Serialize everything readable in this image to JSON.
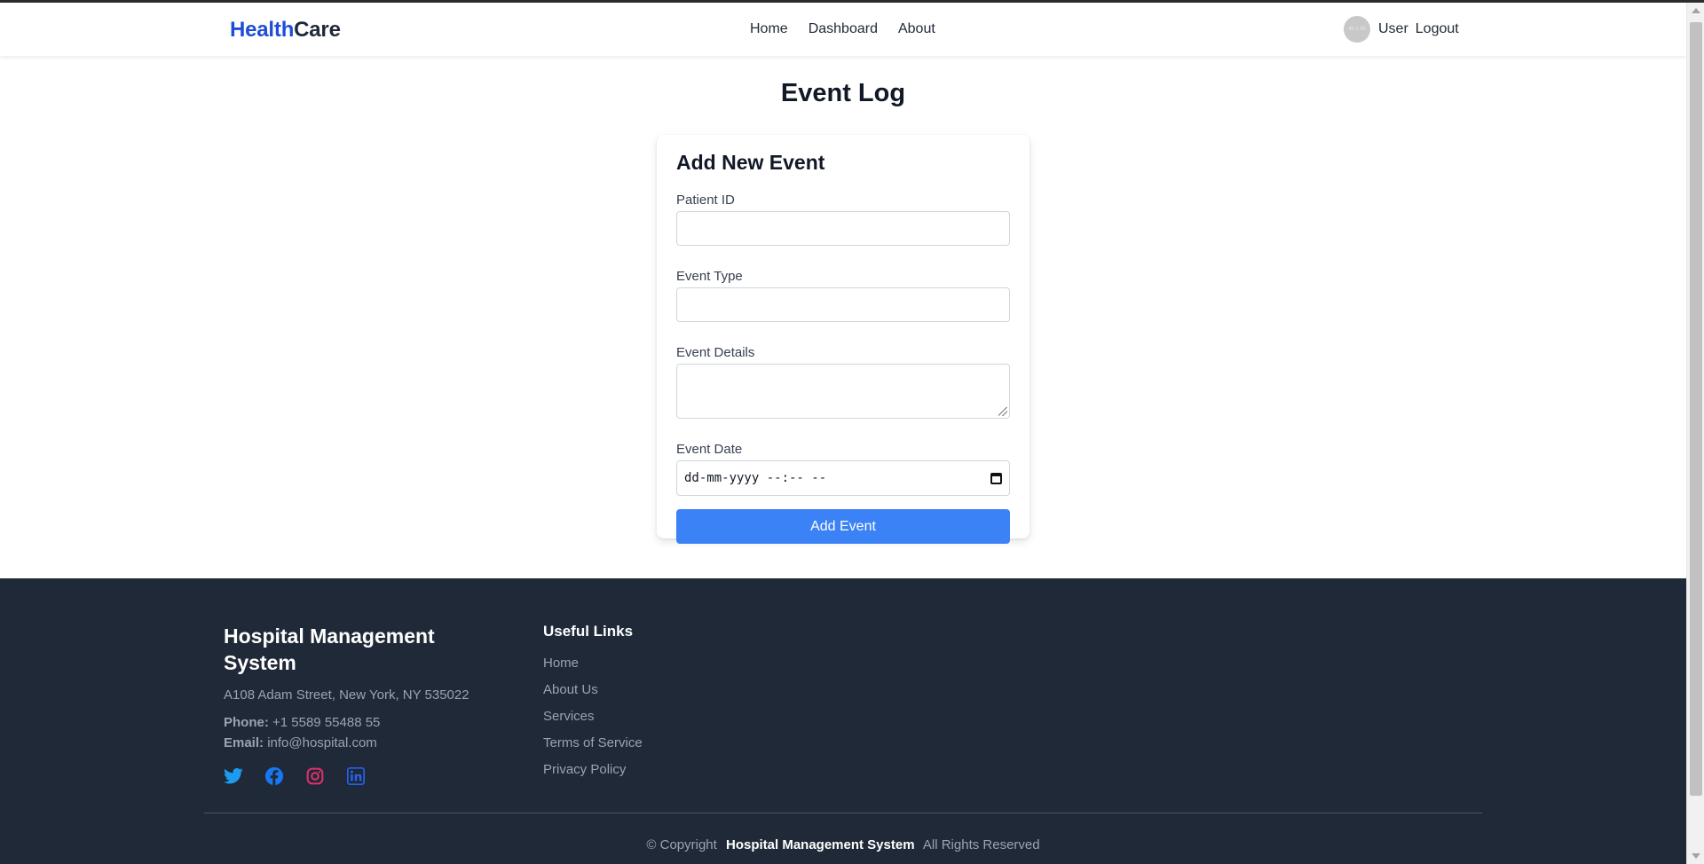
{
  "header": {
    "logo_part1": "Health",
    "logo_part2": "Care",
    "nav": [
      "Home",
      "Dashboard",
      "About"
    ],
    "avatar_text": "40 x 40",
    "user_label": "User",
    "logout_label": "Logout"
  },
  "main": {
    "title": "Event Log",
    "form": {
      "title": "Add New Event",
      "patient_id_label": "Patient ID",
      "patient_id_value": "",
      "event_type_label": "Event Type",
      "event_type_value": "",
      "event_details_label": "Event Details",
      "event_details_value": "",
      "event_date_label": "Event Date",
      "event_date_placeholder": "dd-mm-yyyy --:-- --",
      "submit_label": "Add Event"
    }
  },
  "footer": {
    "brand": "Hospital Management System",
    "address": "A108 Adam Street, New York, NY 535022",
    "phone_label": "Phone:",
    "phone_value": "+1 5589 55488 55",
    "email_label": "Email:",
    "email_value": "info@hospital.com",
    "socials": [
      "twitter-icon",
      "facebook-icon",
      "instagram-icon",
      "linkedin-icon"
    ],
    "links_title": "Useful Links",
    "links": [
      "Home",
      "About Us",
      "Services",
      "Terms of Service",
      "Privacy Policy"
    ],
    "copyright_prefix": "© Copyright",
    "copyright_name": "Hospital Management System",
    "copyright_suffix": "All Rights Reserved"
  },
  "colors": {
    "brand_blue": "#1d4ed8",
    "button_blue": "#3b82f6",
    "footer_bg": "#1f2937",
    "twitter": "#1d9bf0",
    "facebook": "#1877f2",
    "instagram": "#e1306c",
    "linkedin": "#2563eb"
  }
}
